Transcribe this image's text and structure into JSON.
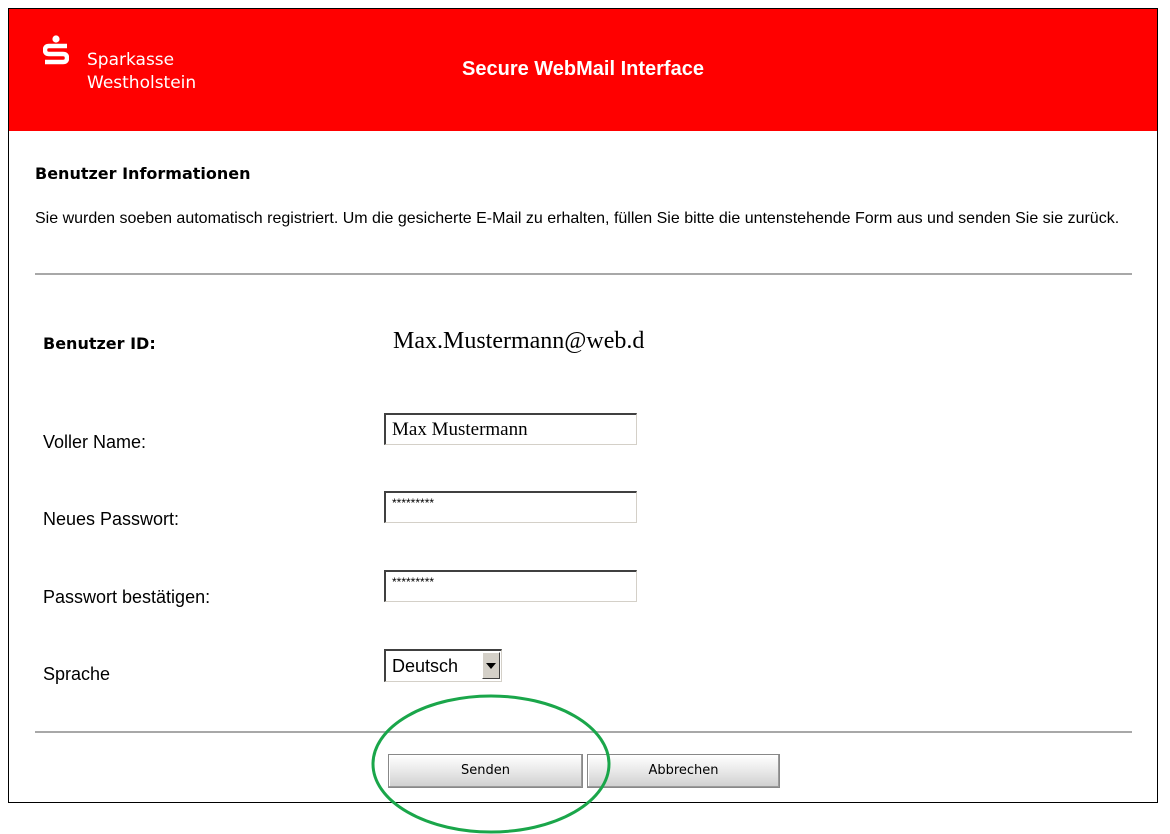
{
  "header": {
    "logo_line1": "Sparkasse",
    "logo_line2": "Westholstein",
    "title": "Secure WebMail Interface",
    "brand_color": "#ff0000",
    "logo_icon": "sparkasse-s-icon"
  },
  "section": {
    "title": "Benutzer Informationen",
    "intro": "Sie wurden soeben automatisch registriert.  Um die gesicherte E-Mail zu erhalten, füllen Sie bitte die untenstehende Form aus und senden Sie sie zurück."
  },
  "form": {
    "user_id_label": "Benutzer ID:",
    "user_id_value": "Max.Mustermann@web.d",
    "full_name_label": "Voller Name:",
    "full_name_value": "Max Mustermann",
    "new_password_label": "Neues Passwort:",
    "new_password_value": "*********",
    "confirm_password_label": "Passwort bestätigen:",
    "confirm_password_value": "*********",
    "language_label": "Sprache",
    "language_selected": "Deutsch"
  },
  "buttons": {
    "send": "Senden",
    "cancel": "Abbrechen"
  },
  "annotation": {
    "highlight_color": "#1aa64a"
  }
}
